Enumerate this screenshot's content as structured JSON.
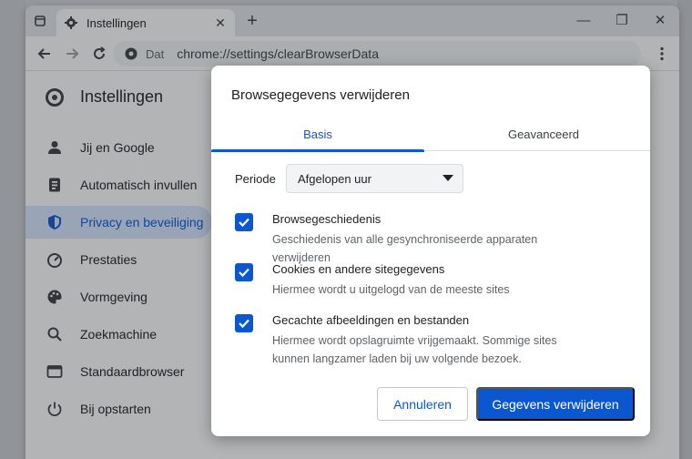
{
  "browser": {
    "tab_title": "Instellingen",
    "omnibox_chip": "Dat",
    "url": "chrome://settings/clearBrowserData"
  },
  "settings": {
    "title": "Instellingen",
    "nav": [
      {
        "label": "Jij en Google",
        "icon": "person-icon"
      },
      {
        "label": "Automatisch invullen",
        "icon": "autofill-icon"
      },
      {
        "label": "Privacy en beveiliging",
        "icon": "shield-icon",
        "active": true
      },
      {
        "label": "Prestaties",
        "icon": "speedometer-icon"
      },
      {
        "label": "Vormgeving",
        "icon": "palette-icon"
      },
      {
        "label": "Zoekmachine",
        "icon": "search-icon"
      },
      {
        "label": "Standaardbrowser",
        "icon": "browser-icon"
      },
      {
        "label": "Bij opstarten",
        "icon": "power-icon"
      }
    ]
  },
  "dialog": {
    "title": "Browsegegevens verwijderen",
    "tabs": [
      "Basis",
      "Geavanceerd"
    ],
    "period_label": "Periode",
    "period_value": "Afgelopen uur",
    "items": [
      {
        "title": "Browsegeschiedenis",
        "desc": "Geschiedenis van alle gesynchroniseerde apparaten verwijderen",
        "checked": true
      },
      {
        "title": "Cookies en andere sitegegevens",
        "desc": "Hiermee wordt u uitgelogd van de meeste sites",
        "checked": true
      },
      {
        "title": "Gecachte afbeeldingen en bestanden",
        "desc": "Hiermee wordt opslagruimte vrijgemaakt. Sommige sites kunnen langzamer laden bij uw volgende bezoek.",
        "checked": true
      }
    ],
    "cancel_label": "Annuleren",
    "confirm_label": "Gegevens verwijderen"
  },
  "colors": {
    "accent": "#0b57d0",
    "active_nav_bg": "#d3e3fd"
  }
}
